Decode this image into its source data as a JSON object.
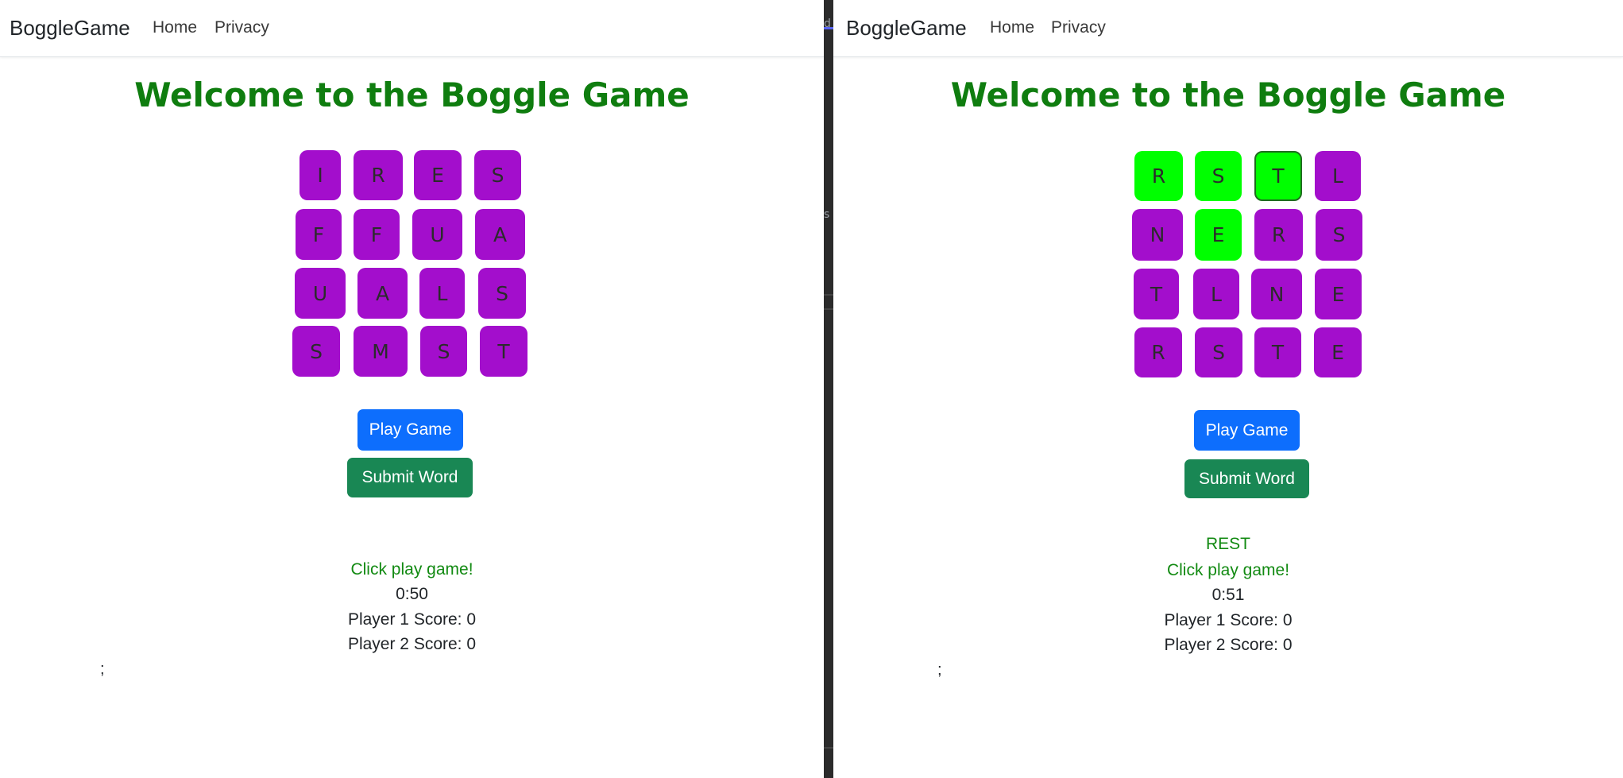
{
  "colors": {
    "title": "#0f7d0f",
    "tile": "#a30ecc",
    "tile_selected": "#00ff00",
    "play_button": "#0d6efd",
    "submit_button": "#198754",
    "message": "#128a12"
  },
  "left": {
    "nav": {
      "brand": "BoggleGame",
      "home": "Home",
      "privacy": "Privacy"
    },
    "title": "Welcome to the Boggle Game",
    "board": [
      [
        "I",
        "R",
        "E",
        "S"
      ],
      [
        "F",
        "F",
        "U",
        "A"
      ],
      [
        "U",
        "A",
        "L",
        "S"
      ],
      [
        "S",
        "M",
        "S",
        "T"
      ]
    ],
    "selected_tiles": [],
    "play_button": "Play Game",
    "submit_button": "Submit Word",
    "current_word": "",
    "message": "Click play game!",
    "timer": "0:50",
    "player1_score": "Player 1 Score: 0",
    "player2_score": "Player 2 Score: 0",
    "stray_text": ";"
  },
  "right": {
    "nav": {
      "brand": "BoggleGame",
      "home": "Home",
      "privacy": "Privacy"
    },
    "title": "Welcome to the Boggle Game",
    "board": [
      [
        "R",
        "S",
        "T",
        "L"
      ],
      [
        "N",
        "E",
        "R",
        "S"
      ],
      [
        "T",
        "L",
        "N",
        "E"
      ],
      [
        "R",
        "S",
        "T",
        "E"
      ]
    ],
    "selected_tiles": [
      "R",
      "S",
      "T",
      "E"
    ],
    "play_button": "Play Game",
    "submit_button": "Submit Word",
    "current_word": "REST",
    "message": "Click play game!",
    "timer": "0:51",
    "player1_score": "Player 1 Score: 0",
    "player2_score": "Player 2 Score: 0",
    "stray_text": ";"
  },
  "divider_fragments": [
    "de",
    "sh"
  ]
}
